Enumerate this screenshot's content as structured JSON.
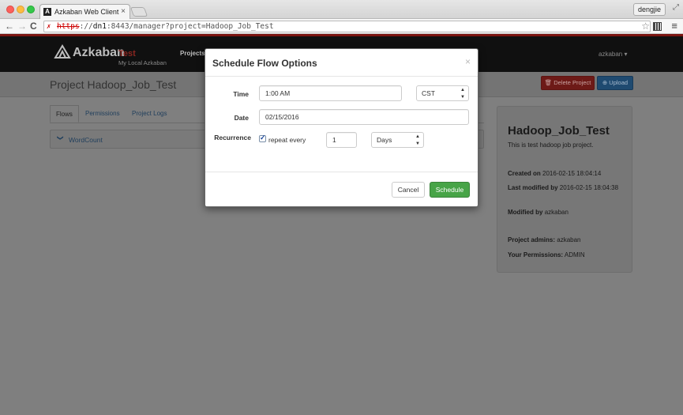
{
  "browser": {
    "tab_title": "Azkaban Web Client",
    "tab_favicon": "azkaban-favicon",
    "tab_close": "×",
    "user_button": "dengjie",
    "url_scheme": "https",
    "url_rest_prefix": "://",
    "url_host": "dn1",
    "url_path": ":8443/manager?project=Hadoop_Job_Test",
    "icons": {
      "back": "←",
      "forward": "→",
      "reload": "C",
      "lock": "✗",
      "star": "☆",
      "menu": "≡",
      "resize": "⤢"
    }
  },
  "navbar": {
    "brand": "Azkaban",
    "environment": "Test",
    "subtitle": "My Local Azkaban",
    "projects_link": "Projects",
    "user_menu": "azkaban ▾"
  },
  "header": {
    "title": "Project Hadoop_Job_Test",
    "delete_button": "🗑 Delete Project",
    "upload_button": "⊕ Upload"
  },
  "content": {
    "tabs": [
      {
        "label": "Flows"
      },
      {
        "label": "Permissions"
      },
      {
        "label": "Project Logs"
      }
    ],
    "flow_chevron": "❯",
    "flow_name": "WordCount"
  },
  "sidebar": {
    "project_name": "Hadoop_Job_Test",
    "description": "This is test hadoop job project.",
    "created_label": "Created on",
    "created_value": "2016-02-15 18:04:14",
    "modified_label": "Last modified by",
    "modified_value": "2016-02-15 18:04:38",
    "modified_by_label": "Modified by",
    "modified_by_value": "azkaban",
    "admins_label": "Project admins:",
    "admins_value": "azkaban",
    "permissions_label": "Your Permissions:",
    "permissions_value": "ADMIN"
  },
  "modal": {
    "title": "Schedule Flow Options",
    "close": "×",
    "time_label": "Time",
    "time_value": "1:00 AM",
    "timezone": "CST",
    "date_label": "Date",
    "date_value": "02/15/2016",
    "recurrence_label": "Recurrence",
    "repeat_checked": true,
    "repeat_label": "repeat every",
    "repeat_value": "1",
    "repeat_unit": "Days",
    "select_arrow": "▲▼",
    "cancel_button": "Cancel",
    "schedule_button": "Schedule"
  },
  "colors": {
    "schedule_green": "#47a447",
    "delete_red": "#d9534f",
    "upload_blue": "#428bca",
    "navbar_black": "#101010"
  }
}
